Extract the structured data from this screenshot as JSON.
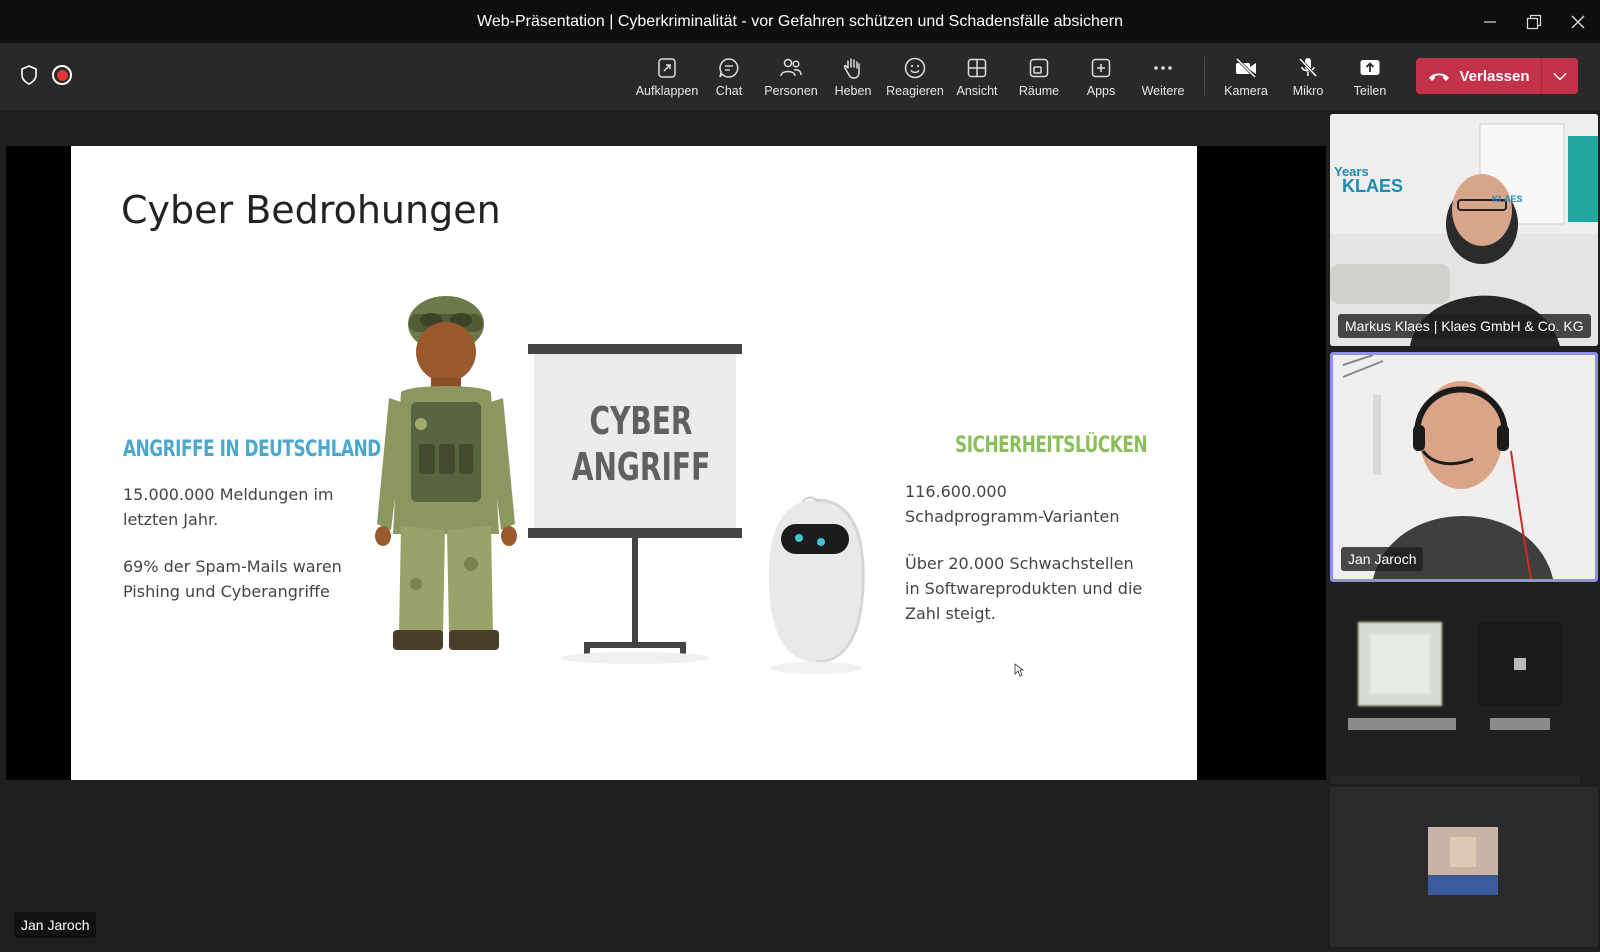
{
  "window": {
    "title": "Web-Präsentation | Cyberkriminalität - vor Gefahren schützen und Schadensfälle absichern"
  },
  "toolbar": {
    "items": [
      {
        "label": "Aufklappen",
        "icon": "expand-icon"
      },
      {
        "label": "Chat",
        "icon": "chat-icon"
      },
      {
        "label": "Personen",
        "icon": "people-icon"
      },
      {
        "label": "Heben",
        "icon": "raise-hand-icon"
      },
      {
        "label": "Reagieren",
        "icon": "smiley-icon"
      },
      {
        "label": "Ansicht",
        "icon": "grid-icon"
      },
      {
        "label": "Räume",
        "icon": "rooms-icon"
      },
      {
        "label": "Apps",
        "icon": "add-app-icon"
      },
      {
        "label": "Weitere",
        "icon": "more-icon"
      }
    ],
    "media": [
      {
        "label": "Kamera",
        "icon": "camera-off-icon"
      },
      {
        "label": "Mikro",
        "icon": "mic-off-icon"
      },
      {
        "label": "Teilen",
        "icon": "share-icon"
      }
    ],
    "leave_label": "Verlassen",
    "leave_color": "#c4314b"
  },
  "slide": {
    "title": "Cyber Bedrohungen",
    "left_heading": "ANGRIFFE IN DEUTSCHLAND",
    "left_point_1": "15.000.000 Meldungen im letzten Jahr.",
    "left_point_2": "69% der Spam-Mails waren Pishing und Cyberangriffe",
    "board_line_1": "CYBER",
    "board_line_2": "ANGRIFF",
    "right_heading": "SICHERHEITSLÜCKEN",
    "right_point_1": "116.600.000  Schadprogramm-Varianten",
    "right_point_2": "Über 20.000 Schwachstellen in Softwareprodukten und die Zahl steigt.",
    "heading_blue": "#4aa7cf",
    "heading_green": "#8cbf5a"
  },
  "participants": {
    "tile_1_name": "Markus Klaes | Klaes GmbH & Co. KG",
    "tile_1_logo_line_1": "Years",
    "tile_1_logo_line_2": "KLAES",
    "tile_1_logo_small": "KLAES",
    "tile_2_name": "Jan Jaroch",
    "active_border": "#8f8ff0"
  },
  "presenter_name": "Jan Jaroch"
}
